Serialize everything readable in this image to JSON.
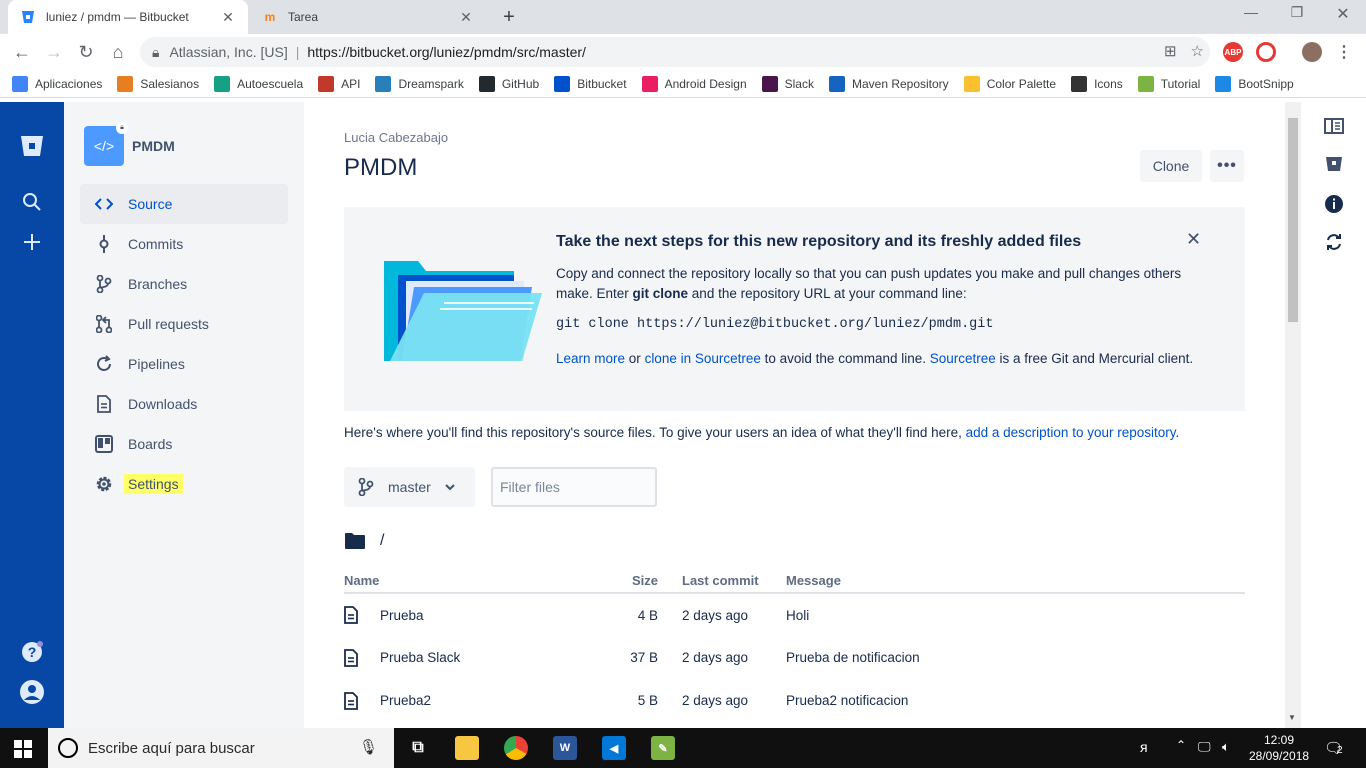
{
  "browser": {
    "tabs": [
      {
        "title": "luniez / pmdm — Bitbucket",
        "active": true
      },
      {
        "title": "Tarea",
        "active": false
      }
    ],
    "url_origin": "Atlassian, Inc. [US]",
    "url": "https://bitbucket.org/luniez/pmdm/src/master/",
    "bookmarks": [
      {
        "label": "Aplicaciones",
        "color": "#4285f4"
      },
      {
        "label": "Salesianos",
        "color": "#e67e22"
      },
      {
        "label": "Autoescuela",
        "color": "#16a085"
      },
      {
        "label": "API",
        "color": "#c0392b"
      },
      {
        "label": "Dreamspark",
        "color": "#2980b9"
      },
      {
        "label": "GitHub",
        "color": "#24292e"
      },
      {
        "label": "Bitbucket",
        "color": "#0052cc"
      },
      {
        "label": "Android Design",
        "color": "#e91e63"
      },
      {
        "label": "Slack",
        "color": "#4a154b"
      },
      {
        "label": "Maven Repository",
        "color": "#1565c0"
      },
      {
        "label": "Color Palette",
        "color": "#fbc02d"
      },
      {
        "label": "Icons",
        "color": "#333333"
      },
      {
        "label": "Tutorial",
        "color": "#7cb342"
      },
      {
        "label": "BootSnipp",
        "color": "#1e88e5"
      }
    ]
  },
  "sidebar": {
    "repo_name": "PMDM",
    "items": [
      {
        "label": "Source",
        "icon": "source-icon"
      },
      {
        "label": "Commits",
        "icon": "commits-icon"
      },
      {
        "label": "Branches",
        "icon": "branches-icon"
      },
      {
        "label": "Pull requests",
        "icon": "pull-requests-icon"
      },
      {
        "label": "Pipelines",
        "icon": "pipelines-icon"
      },
      {
        "label": "Downloads",
        "icon": "downloads-icon"
      },
      {
        "label": "Boards",
        "icon": "boards-icon"
      },
      {
        "label": "Settings",
        "icon": "gear-icon"
      }
    ]
  },
  "main": {
    "owner": "Lucia Cabezabajo",
    "title": "PMDM",
    "clone_label": "Clone",
    "more_label": "•••",
    "banner": {
      "heading": "Take the next steps for this new repository and its freshly added files",
      "p1_a": "Copy and connect the repository locally so that you can push updates you make and pull changes others make. Enter ",
      "p1_bold": "git clone",
      "p1_b": " and the repository URL at your command line:",
      "code": "git clone https://luniez@bitbucket.org/luniez/pmdm.git",
      "link1": "Learn more",
      "or": " or ",
      "link2": "clone in Sourcetree",
      "p2_a": " to avoid the command line. ",
      "link3": "Sourcetree",
      "p2_b": " is a free Git and Mercurial client."
    },
    "intro_text": "Here's where you'll find this repository's source files. To give your users an idea of what they'll find here, ",
    "intro_link": "add a description to your repository",
    "intro_end": ".",
    "branch": "master",
    "filter_placeholder": "Filter files",
    "path": "/",
    "columns": [
      "Name",
      "Size",
      "Last commit",
      "Message"
    ],
    "files": [
      {
        "name": "Prueba",
        "size": "4 B",
        "last_commit": "2 days ago",
        "message": "Holi"
      },
      {
        "name": "Prueba Slack",
        "size": "37 B",
        "last_commit": "2 days ago",
        "message": "Prueba de notificacion"
      },
      {
        "name": "Prueba2",
        "size": "5 B",
        "last_commit": "2 days ago",
        "message": "Prueba2 notificacion"
      }
    ]
  },
  "taskbar": {
    "search_placeholder": "Escribe aquí para buscar",
    "time": "12:09",
    "date": "28/09/2018",
    "notifications": "2"
  },
  "colors": {
    "global_nav": "#0747a6",
    "link": "#0052cc",
    "highlight": "#ffff66"
  }
}
